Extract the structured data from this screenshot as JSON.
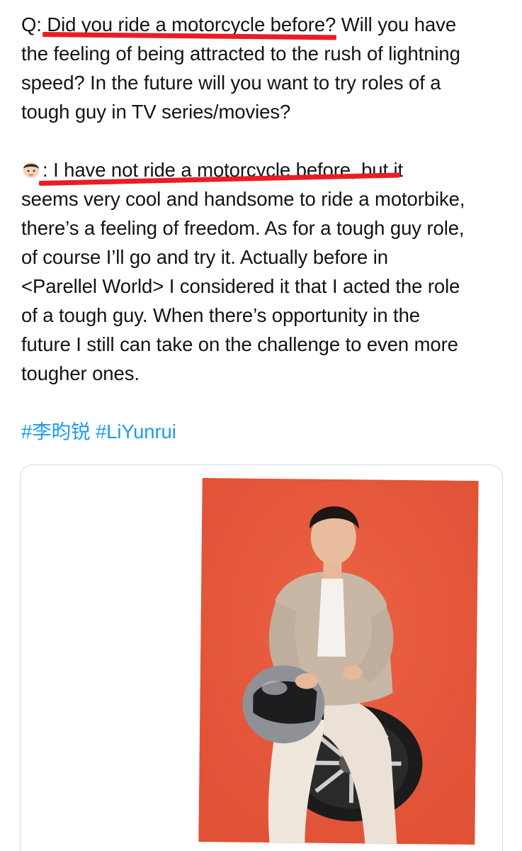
{
  "tweet": {
    "question_lines": [
      "Q: Did you ride a motorcycle before? Will you have",
      "the feeling of being attracted to the rush of lightning",
      "speed? In the future will you want to try roles of a",
      "tough guy in TV series/movies?"
    ],
    "answer_first_line": ": I have not ride a motorcycle before, but it",
    "answer_lines": [
      "seems very cool and handsome to ride a motorbike,",
      "there’s a feeling of freedom. As for a tough guy role,",
      "of course I’ll go and try it. Actually before in",
      "<Parellel World> I considered it that I acted the role",
      "of a tough guy. When there’s opportunity in the",
      "future I still can take on the challenge to even more",
      "tougher ones."
    ],
    "hashtags": [
      "#李昀锐",
      "#LiYunrui"
    ],
    "answer_emoji": "boy-face-emoji"
  },
  "colors": {
    "text": "#0f1419",
    "link": "#1d9bf0",
    "underline": "#ec1c24",
    "photo_background": "#e8583c",
    "card_border": "#cfd9de"
  },
  "media": {
    "subject": "man in beige jacket seated on motorcycle wheel holding helmet"
  }
}
